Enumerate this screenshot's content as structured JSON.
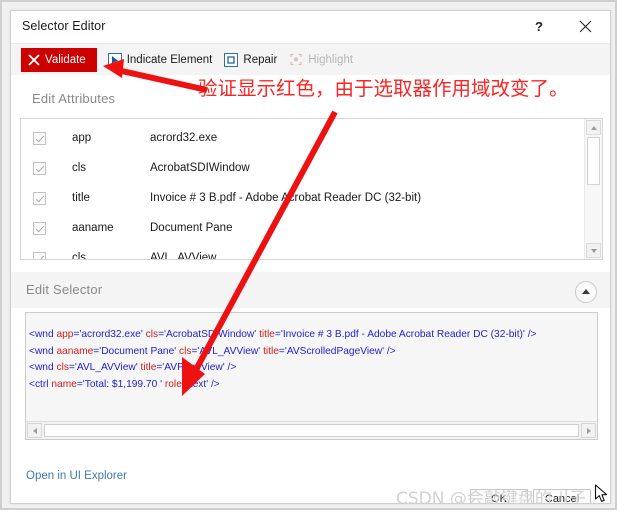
{
  "window": {
    "title": "Selector Editor",
    "help_label": "?",
    "close_label": "✕"
  },
  "toolbar": {
    "validate_label": "Validate",
    "validate_icon": "x-mark-icon",
    "validate_color": "#cc0000",
    "indicate_label": "Indicate Element",
    "indicate_icon": "cursor-arrow-icon",
    "repair_label": "Repair",
    "repair_icon": "square-outline-icon",
    "highlight_label": "Highlight",
    "highlight_icon": "highlight-icon"
  },
  "attributes_section": {
    "label": "Edit Attributes",
    "rows": [
      {
        "checked": true,
        "name": "app",
        "value": "acrord32.exe"
      },
      {
        "checked": true,
        "name": "cls",
        "value": "AcrobatSDIWindow"
      },
      {
        "checked": true,
        "name": "title",
        "value": "Invoice # 3 B.pdf - Adobe Acrobat Reader DC (32-bit)"
      },
      {
        "checked": true,
        "name": "aaname",
        "value": "Document Pane"
      },
      {
        "checked": true,
        "name": "cls",
        "value": "AVL_AVView"
      }
    ]
  },
  "selector_section": {
    "label": "Edit Selector",
    "collapse_icon": "chevron-up-icon",
    "lines": [
      [
        {
          "t": "tag",
          "s": "<wnd "
        },
        {
          "t": "attr",
          "s": "app"
        },
        {
          "t": "val",
          "s": "='acrord32.exe' "
        },
        {
          "t": "attr",
          "s": "cls"
        },
        {
          "t": "val",
          "s": "='AcrobatSDIWindow' "
        },
        {
          "t": "attr",
          "s": "title"
        },
        {
          "t": "val",
          "s": "='Invoice # 3 B.pdf - Adobe Acrobat Reader DC (32-bit)' />"
        }
      ],
      [
        {
          "t": "tag",
          "s": "<wnd "
        },
        {
          "t": "attr",
          "s": "aaname"
        },
        {
          "t": "val",
          "s": "='Document Pane' "
        },
        {
          "t": "attr",
          "s": "cls"
        },
        {
          "t": "val",
          "s": "='AVL_AVView' "
        },
        {
          "t": "attr",
          "s": "title"
        },
        {
          "t": "val",
          "s": "='AVScrolledPageView' />"
        }
      ],
      [
        {
          "t": "tag",
          "s": "<wnd "
        },
        {
          "t": "attr",
          "s": "cls"
        },
        {
          "t": "val",
          "s": "='AVL_AVView' "
        },
        {
          "t": "attr",
          "s": "title"
        },
        {
          "t": "val",
          "s": "='AVPageView' />"
        }
      ],
      [
        {
          "t": "tag",
          "s": "<ctrl "
        },
        {
          "t": "attr",
          "s": "name"
        },
        {
          "t": "val",
          "s": "='Total:   $1,199.70   ' "
        },
        {
          "t": "attr",
          "s": "role"
        },
        {
          "t": "val",
          "s": "='text' />"
        }
      ]
    ]
  },
  "footer": {
    "ui_explorer_label": "Open in UI Explorer",
    "ok_label": "OK",
    "cancel_label": "Cancel"
  },
  "annotations": {
    "note_text": "验证显示红色，由于选取器作用域改变了。",
    "note_color": "#fb2424",
    "arrow_color": "#ee1111"
  },
  "watermark": {
    "text": "CSDN @会敲键盘的刂子"
  }
}
